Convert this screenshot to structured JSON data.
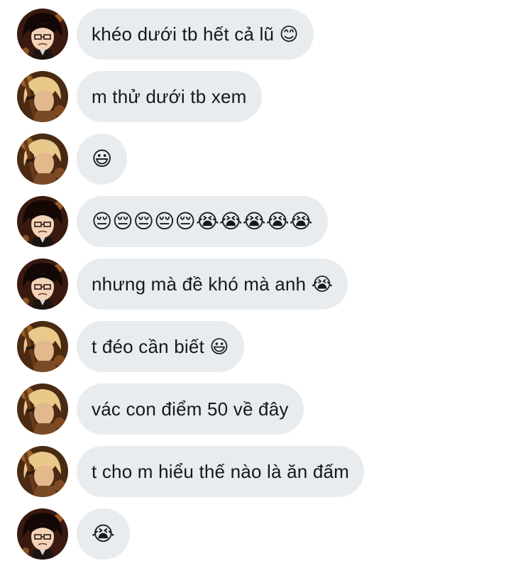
{
  "avatars": {
    "a": "dark-haired-anime-character-avatar",
    "b": "blonde-anime-character-with-sword-avatar"
  },
  "messages": [
    {
      "avatar": "a",
      "text": "khéo dưới tb hết cả lũ 😊"
    },
    {
      "avatar": "b",
      "text": "m thử dưới tb xem"
    },
    {
      "avatar": "b",
      "text": "😃"
    },
    {
      "avatar": "a",
      "text": "😔😔😔😔😔😭😭😭😭😭"
    },
    {
      "avatar": "a",
      "text": "nhưng mà đề khó mà anh 😭"
    },
    {
      "avatar": "b",
      "text": "t đéo cần biết 😃"
    },
    {
      "avatar": "b",
      "text": "vác con điểm 50 về đây"
    },
    {
      "avatar": "b",
      "text": "t cho m hiểu thế nào là ăn đấm"
    },
    {
      "avatar": "a",
      "text": "😭"
    }
  ],
  "colors": {
    "bubble": "#e9ecef",
    "text": "#16181c",
    "background": "#ffffff"
  }
}
